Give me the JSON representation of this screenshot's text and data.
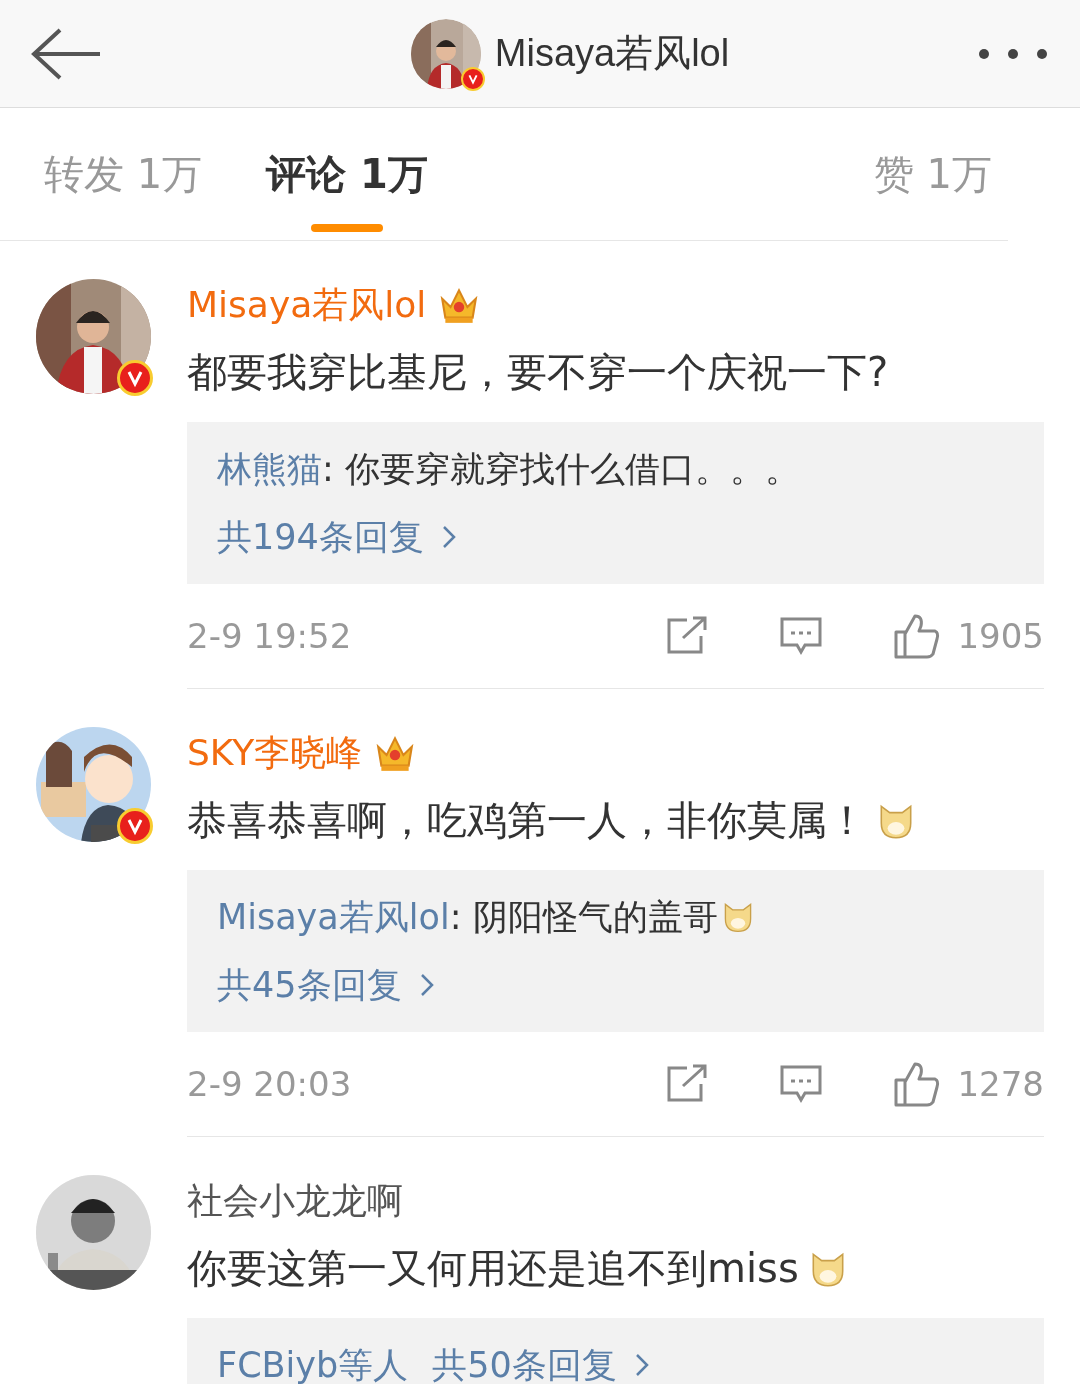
{
  "header": {
    "title": "Misaya若风lol",
    "verified": true
  },
  "tabs": [
    {
      "label": "转发 1万",
      "selected": false
    },
    {
      "label": "评论 1万",
      "selected": true
    },
    {
      "label": "赞 1万",
      "selected": false
    }
  ],
  "comments": [
    {
      "author": "Misaya若风lol",
      "vip": true,
      "verified": true,
      "text": "都要我穿比基尼，要不穿一个庆祝一下?",
      "emoji": false,
      "reply": {
        "user": "林熊猫",
        "text": ": 你要穿就穿找什么借口。。。",
        "emoji": false,
        "count": "共194条回复"
      },
      "time": "2-9 19:52",
      "likes": "1905"
    },
    {
      "author": "SKY李晓峰",
      "vip": true,
      "verified": true,
      "text": "恭喜恭喜啊，吃鸡第一人，非你莫属！",
      "emoji": true,
      "reply": {
        "user": "Misaya若风lol",
        "text": ": 阴阳怪气的盖哥",
        "emoji": true,
        "count": "共45条回复"
      },
      "time": "2-9 20:03",
      "likes": "1278"
    },
    {
      "author": "社会小龙龙啊",
      "vip": false,
      "verified": false,
      "text": "你要这第一又何用还是追不到miss",
      "emoji": true,
      "reply": {
        "user": "FCBiyb等人",
        "emoji": false,
        "count": "共50条回复"
      }
    }
  ]
}
